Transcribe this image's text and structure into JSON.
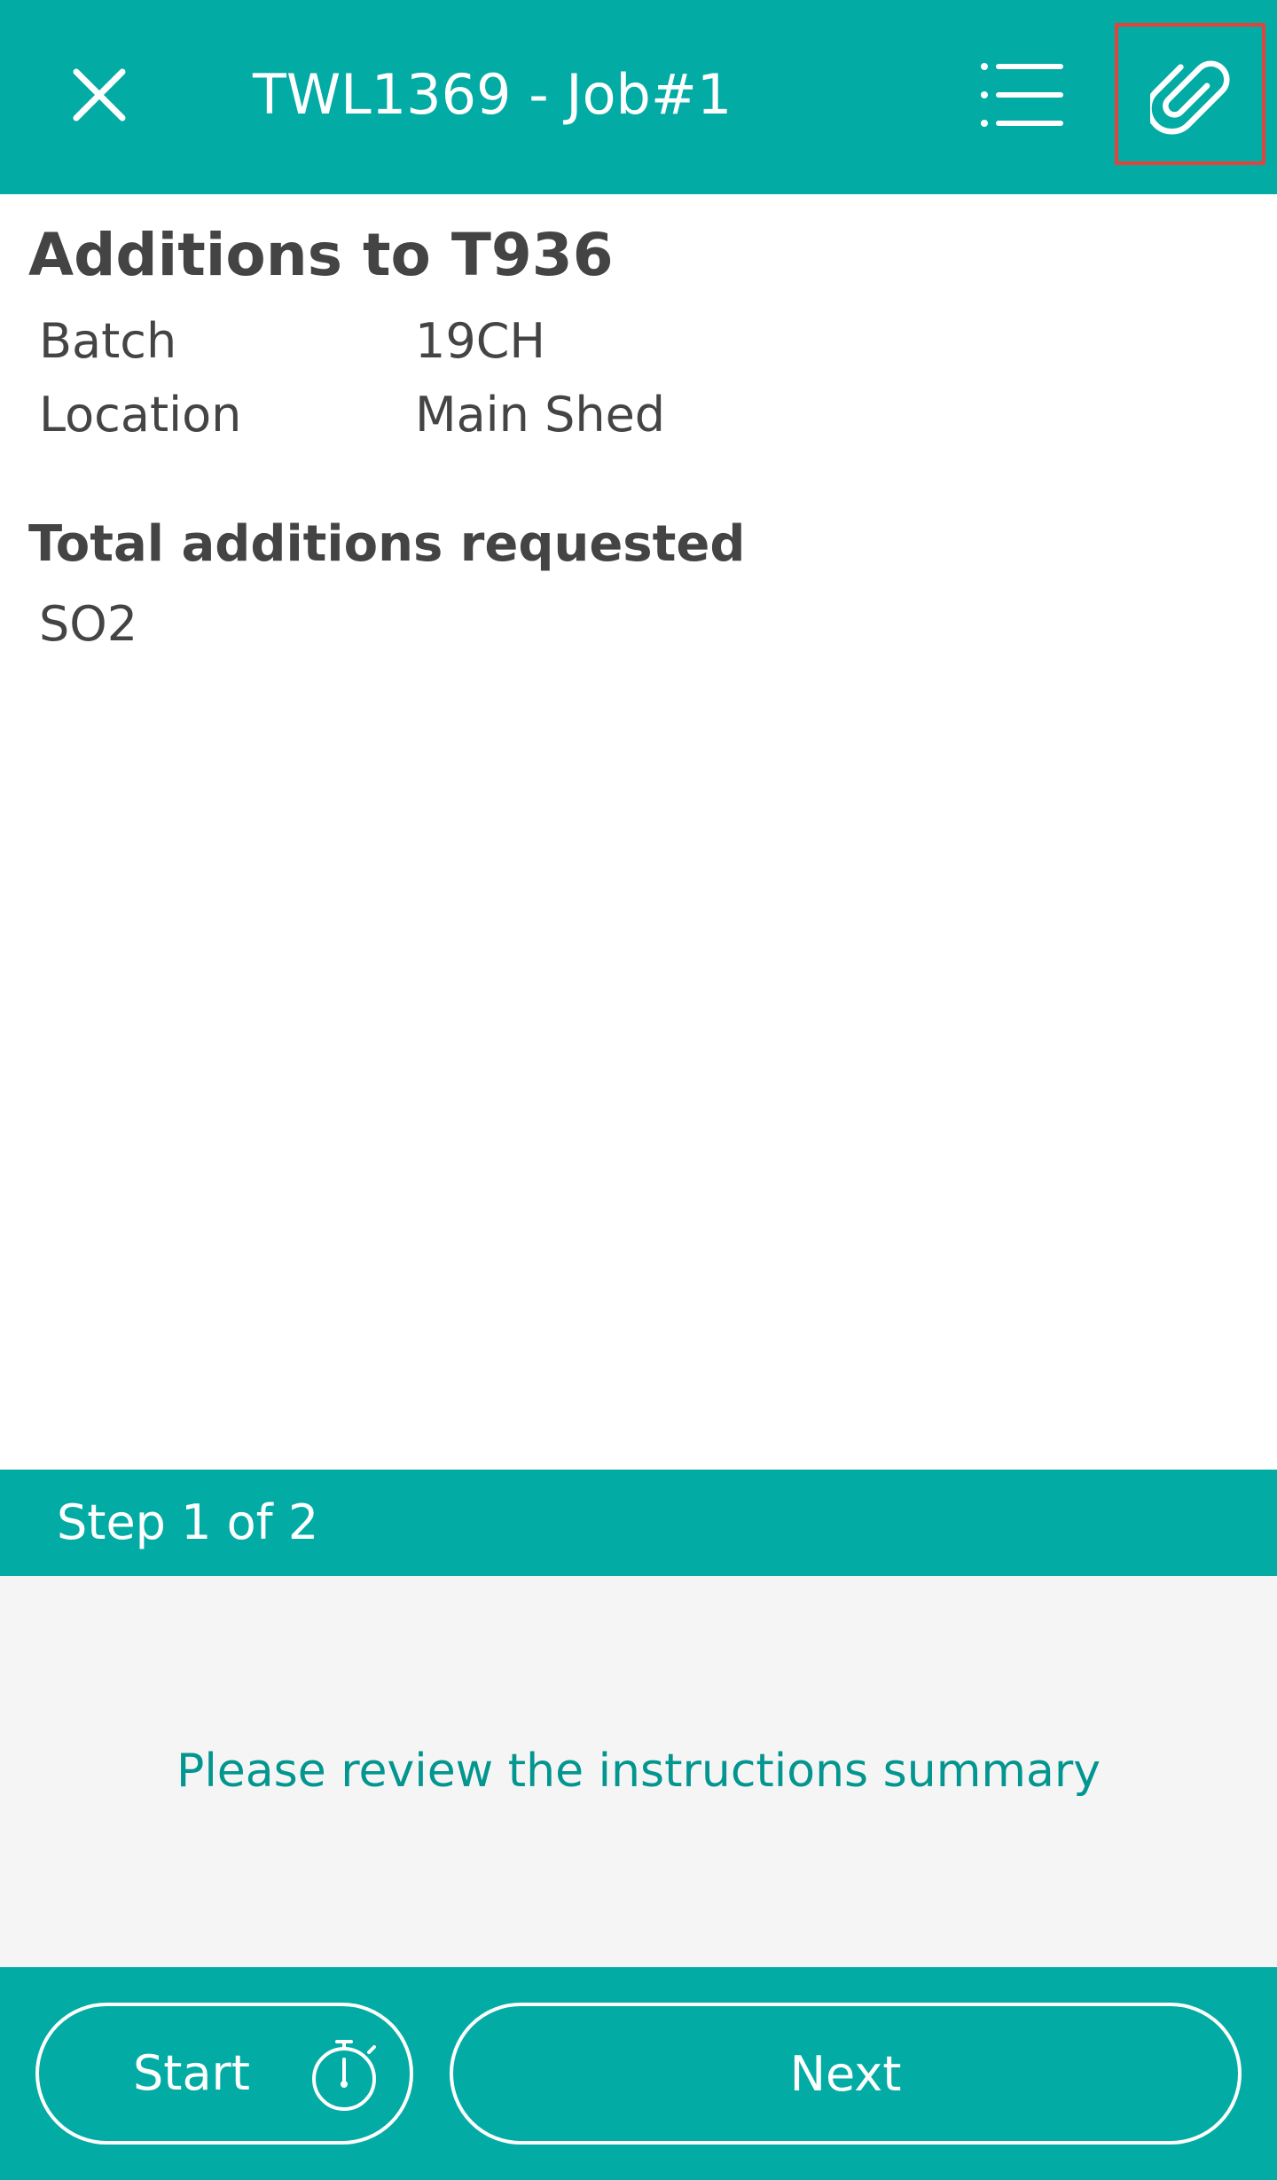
{
  "header": {
    "title": "TWL1369 - Job#1",
    "close_icon": "close-icon",
    "list_icon": "list-icon",
    "attach_icon": "paperclip-icon"
  },
  "content": {
    "heading": "Additions to T936",
    "details": [
      {
        "label": "Batch",
        "value": "19CH"
      },
      {
        "label": "Location",
        "value": "Main Shed"
      }
    ],
    "subheading": "Total additions requested",
    "additions": [
      "SO2"
    ]
  },
  "step": {
    "text": "Step 1 of 2"
  },
  "instructions": {
    "text": "Please review the instructions summary"
  },
  "footer": {
    "start_label": "Start",
    "timer_icon": "stopwatch-icon",
    "next_label": "Next"
  },
  "colors": {
    "brand": "#03ABA5",
    "instruction_text": "#03958F",
    "highlight": "#E0443C",
    "panel": "#F5F5F5"
  }
}
